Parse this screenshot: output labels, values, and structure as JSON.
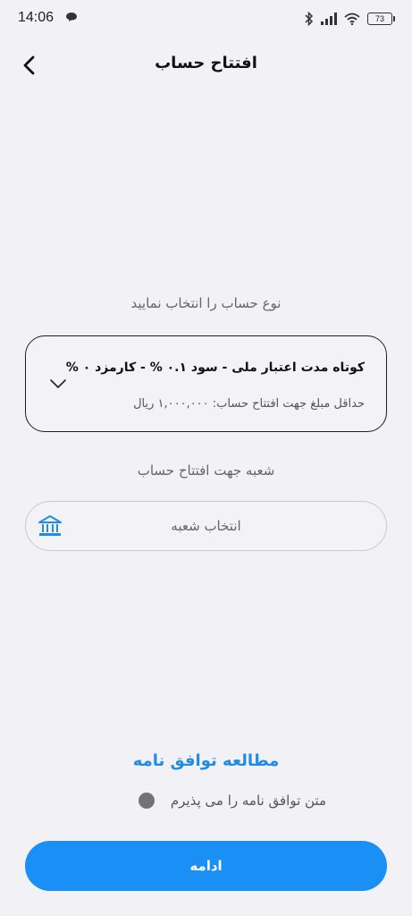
{
  "status_bar": {
    "time": "14:06",
    "battery": "73",
    "icons": [
      "message-icon",
      "bluetooth-icon",
      "signal-icon",
      "wifi-icon",
      "battery-icon"
    ]
  },
  "header": {
    "title": "افتتاح حساب",
    "back_icon": "chevron-left-icon"
  },
  "account_type": {
    "label": "نوع حساب را انتخاب نمایید",
    "selected_title": "کوتاه مدت اعتبار ملی  -  سود ۰.۱ %  -  کارمزد ۰ %",
    "min_amount": "حداقل مبلغ جهت افتتاح حساب:  ۱,۰۰۰,۰۰۰ ریال",
    "chevron_icon": "chevron-down-icon"
  },
  "branch": {
    "label": "شعبه جهت افتتاح حساب",
    "placeholder": "انتخاب شعبه",
    "icon": "bank-icon"
  },
  "agreement": {
    "link_label": "مطالعه توافق نامه",
    "accept_label": "متن توافق نامه را می پذیرم",
    "accepted": false
  },
  "continue_button": {
    "label": "ادامه"
  },
  "colors": {
    "background": "#f1f1f6",
    "accent": "#1a8ff5",
    "link": "#1f8de3"
  }
}
